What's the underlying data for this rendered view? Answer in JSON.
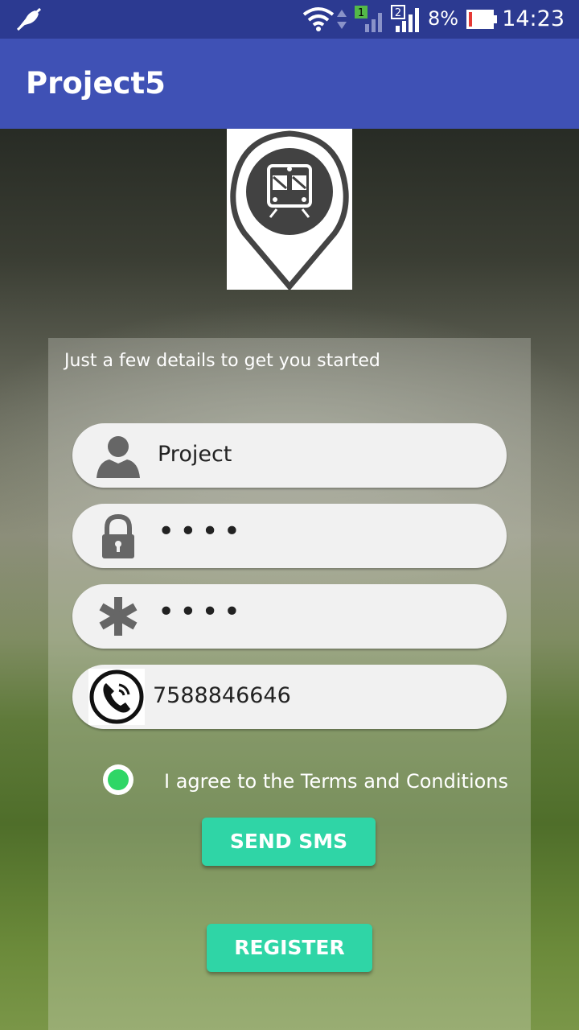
{
  "status_bar": {
    "battery_percent": "8%",
    "time": "14:23",
    "sim1": "1",
    "sim2": "2"
  },
  "app_bar": {
    "title": "Project5"
  },
  "form": {
    "intro": "Just a few details to get you started",
    "username": "Project",
    "password_mask": "••••",
    "confirm_mask": "••••",
    "phone": "7588846646",
    "agree_label": "I agree to the Terms and Conditions",
    "send_sms": "SEND SMS",
    "register": "REGISTER"
  }
}
